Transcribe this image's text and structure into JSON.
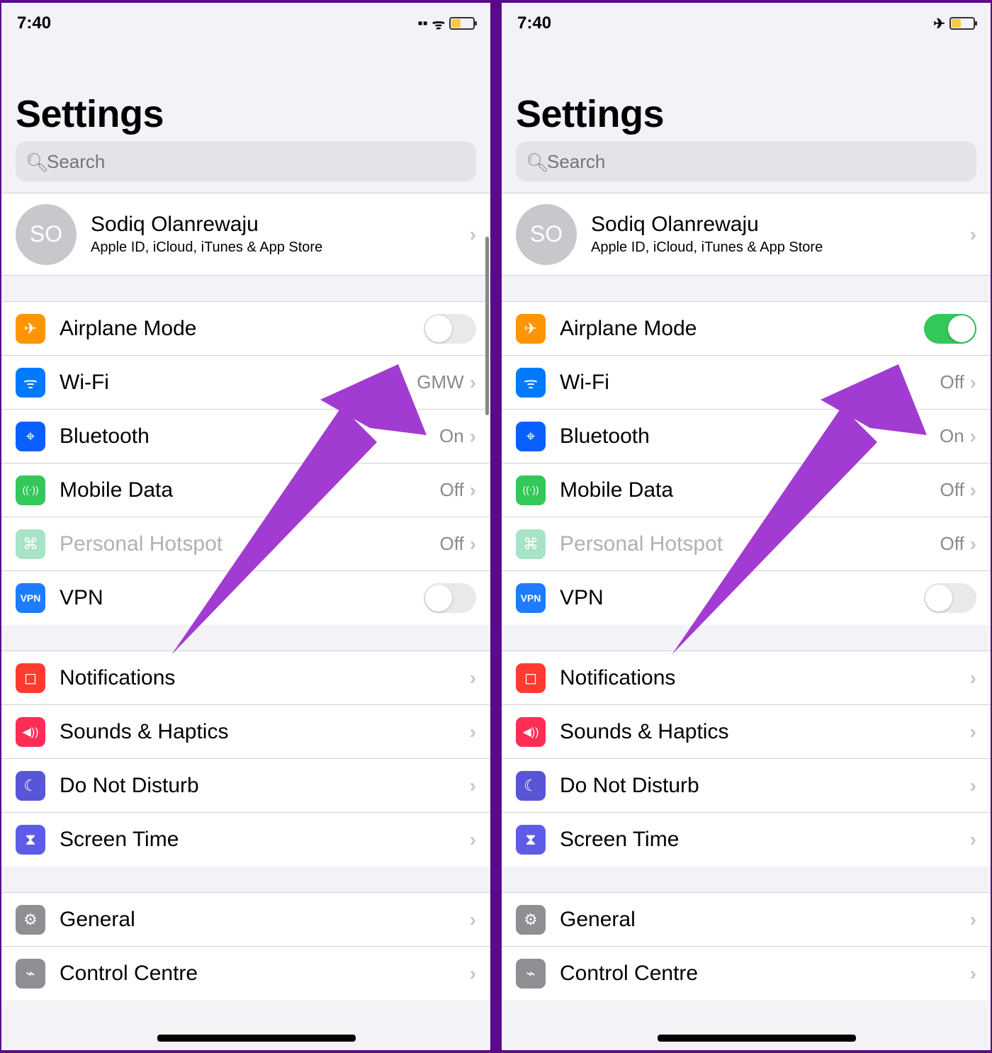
{
  "common": {
    "time": "7:40",
    "title": "Settings",
    "search_placeholder": "Search",
    "profile": {
      "initials": "SO",
      "name": "Sodiq Olanrewaju",
      "subtitle": "Apple ID, iCloud, iTunes & App Store"
    }
  },
  "label": {
    "airplane": "Airplane Mode",
    "wifi": "Wi-Fi",
    "bluetooth": "Bluetooth",
    "mobile": "Mobile Data",
    "hotspot": "Personal Hotspot",
    "vpn": "VPN",
    "notifications": "Notifications",
    "sounds": "Sounds & Haptics",
    "dnd": "Do Not Disturb",
    "screentime": "Screen Time",
    "general": "General",
    "control": "Control Centre"
  },
  "left": {
    "status_icons": {
      "signal": true,
      "wifi": true,
      "airplane": false
    },
    "airplane_on": false,
    "wifi_value": "GMW",
    "bt_value": "On",
    "mobile_value": "Off",
    "hotspot_value": "Off",
    "vpn_on": false
  },
  "right": {
    "status_icons": {
      "signal": false,
      "wifi": false,
      "airplane": true
    },
    "airplane_on": true,
    "wifi_value": "Off",
    "bt_value": "On",
    "mobile_value": "Off",
    "hotspot_value": "Off",
    "vpn_on": false
  },
  "glyph": {
    "airplane": "✈",
    "wifi": "ᯤ",
    "bt": "⌵",
    "antenna": "((⋅))",
    "link": "⧉",
    "vpn": "VPN",
    "bell": "◻︎",
    "speaker": "◀︎))",
    "moon": "☾",
    "hourglass": "⧗",
    "gear": "⚙",
    "sliders": "⌁",
    "chevron": "›",
    "magnifier": "🔍"
  },
  "colors": {
    "arrow": "#a23bd1"
  }
}
